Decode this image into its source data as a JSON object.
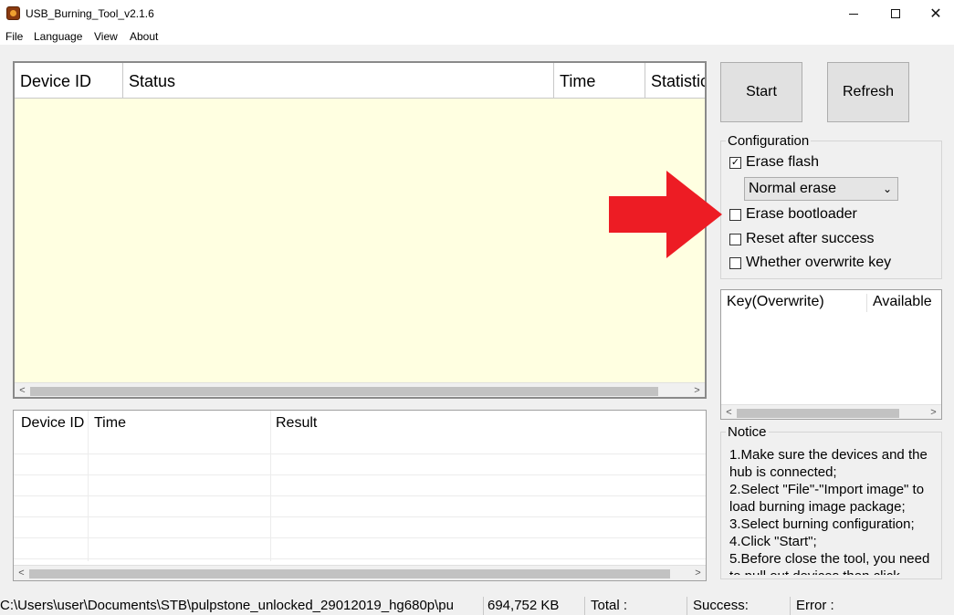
{
  "window": {
    "title": "USB_Burning_Tool_v2.1.6",
    "controls": {
      "minimize": "minimize",
      "maximize": "maximize",
      "close": "✕"
    }
  },
  "menu": [
    "File",
    "Language",
    "View",
    "About"
  ],
  "device_table": {
    "columns": [
      "Device ID",
      "Status",
      "Time",
      "Statistic"
    ],
    "background": "#ffffe1"
  },
  "result_table": {
    "columns": [
      "Device ID",
      "Time",
      "Result"
    ]
  },
  "buttons": {
    "start": "Start",
    "refresh": "Refresh"
  },
  "configuration": {
    "title": "Configuration",
    "erase_flash": {
      "label": "Erase flash",
      "checked": true
    },
    "erase_mode": {
      "selected": "Normal erase"
    },
    "erase_bootloader": {
      "label": "Erase bootloader",
      "checked": false
    },
    "reset_after_success": {
      "label": "Reset after success",
      "checked": false
    },
    "overwrite_key": {
      "label": "Whether overwrite key",
      "checked": false
    }
  },
  "key_table": {
    "columns": [
      "Key(Overwrite)",
      "Available"
    ]
  },
  "notice": {
    "title": "Notice",
    "lines": [
      "1.Make sure the devices and the",
      "hub is connected;",
      "2.Select \"File\"-\"Import image\" to",
      "load burning image package;",
      "3.Select burning configuration;",
      "4.Click \"Start\";",
      "5.Before close the tool, you need",
      "to pull out devices then click"
    ]
  },
  "status_bar": {
    "path": "C:\\Users\\user\\Documents\\STB\\pulpstone_unlocked_29012019_hg680p\\pu",
    "size": "694,752 KB",
    "total": "Total :",
    "success": "Success:",
    "error": "Error :"
  },
  "annotation": {
    "arrow_color": "#ed1c24"
  }
}
